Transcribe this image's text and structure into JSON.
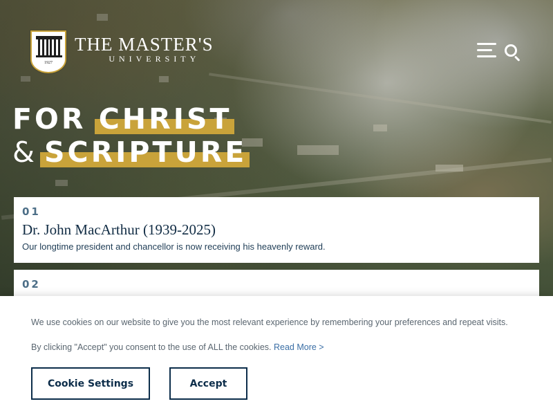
{
  "header": {
    "logo": {
      "name": "THE MASTER'S",
      "subtitle": "UNIVERSITY",
      "year": "1927"
    },
    "menu_icon": "hamburger-menu-icon",
    "search_icon": "search-icon"
  },
  "hero": {
    "line1_a": "FOR",
    "line1_b": "CHRIST",
    "line2_a": "&",
    "line2_b": "SCRIPTURE",
    "highlight_color": "#c9a33a"
  },
  "news": [
    {
      "number": "01",
      "title": "Dr. John MacArthur (1939-2025)",
      "description": "Our longtime president and chancellor is now receiving his heavenly reward."
    },
    {
      "number": "02"
    }
  ],
  "cookie_banner": {
    "message": "We use cookies on our website to give you the most relevant experience by remembering your preferences and repeat visits.",
    "consent": "By clicking \"Accept\" you consent to the use of ALL the cookies.",
    "read_more": "Read More >",
    "settings_button": "Cookie Settings",
    "accept_button": "Accept"
  },
  "colors": {
    "navy": "#0c2d4a",
    "number_blue": "#4c6e87",
    "link": "#3a6ea5"
  }
}
